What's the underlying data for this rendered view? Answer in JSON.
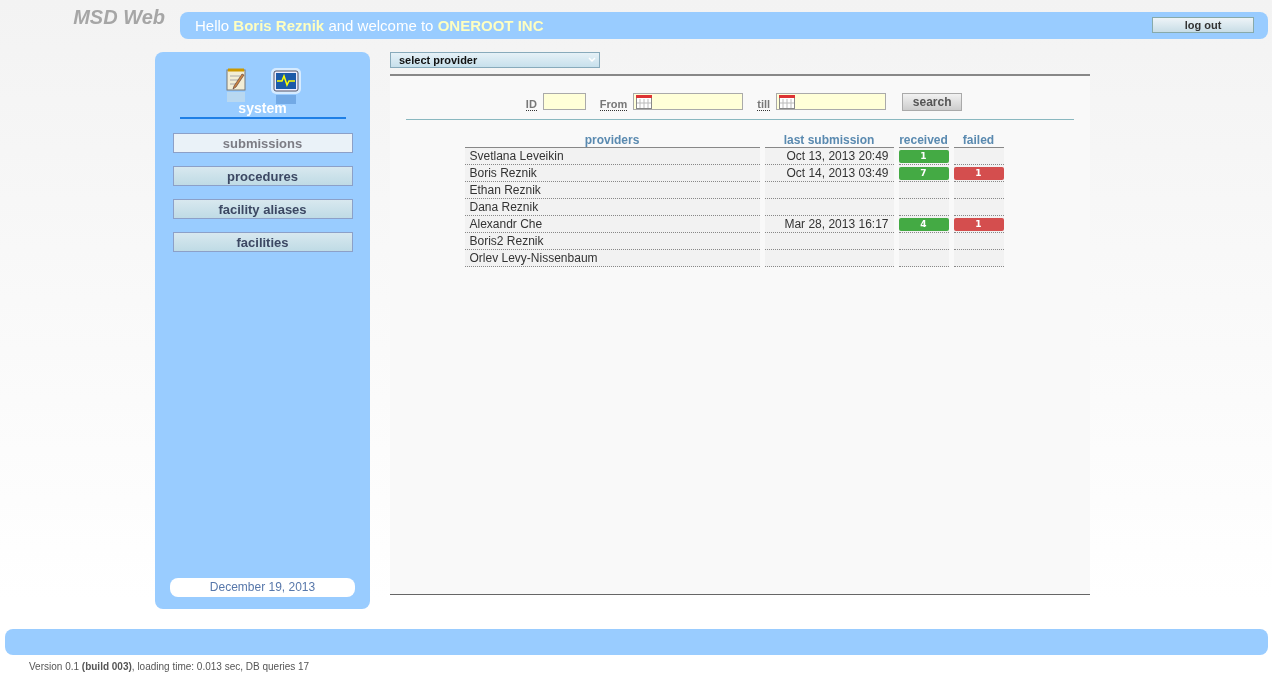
{
  "header": {
    "logo": "MSD Web",
    "greeting": "Hello **Boris Reznik** and welcome to **ONEROOT INC**",
    "logout_button": "log out"
  },
  "sidebar": {
    "section_label": "system",
    "nav": [
      {
        "label": "submissions",
        "selected": true
      },
      {
        "label": "procedures",
        "selected": false
      },
      {
        "label": "facility aliases",
        "selected": false
      },
      {
        "label": "facilities",
        "selected": false
      }
    ],
    "date": "December 19, 2013"
  },
  "provider_select": {
    "value": "select provider"
  },
  "filters": {
    "id_label": "ID",
    "from_label": "From",
    "till_label": "till",
    "search_button": "search"
  },
  "table": {
    "columns": [
      "providers",
      "last submission",
      "received",
      "failed"
    ],
    "rows": [
      {
        "provider": "Svetlana Leveikin",
        "last_submission": "Oct 13, 2013 20:49",
        "received": "1",
        "failed": ""
      },
      {
        "provider": "Boris Reznik",
        "last_submission": "Oct 14, 2013 03:49",
        "received": "7",
        "failed": "1"
      },
      {
        "provider": "Ethan Reznik",
        "last_submission": "",
        "received": "",
        "failed": ""
      },
      {
        "provider": "Dana Reznik",
        "last_submission": "",
        "received": "",
        "failed": ""
      },
      {
        "provider": "Alexandr Che",
        "last_submission": "Mar 28, 2013 16:17",
        "received": "4",
        "failed": "1"
      },
      {
        "provider": "Boris2 Reznik",
        "last_submission": "",
        "received": "",
        "failed": ""
      },
      {
        "provider": "Orlev Levy-Nissenbaum",
        "last_submission": "",
        "received": "",
        "failed": ""
      }
    ]
  },
  "footer": {
    "version": "Version 0.1 **(build 003)**, loading time: 0.013 sec, DB queries 17"
  }
}
